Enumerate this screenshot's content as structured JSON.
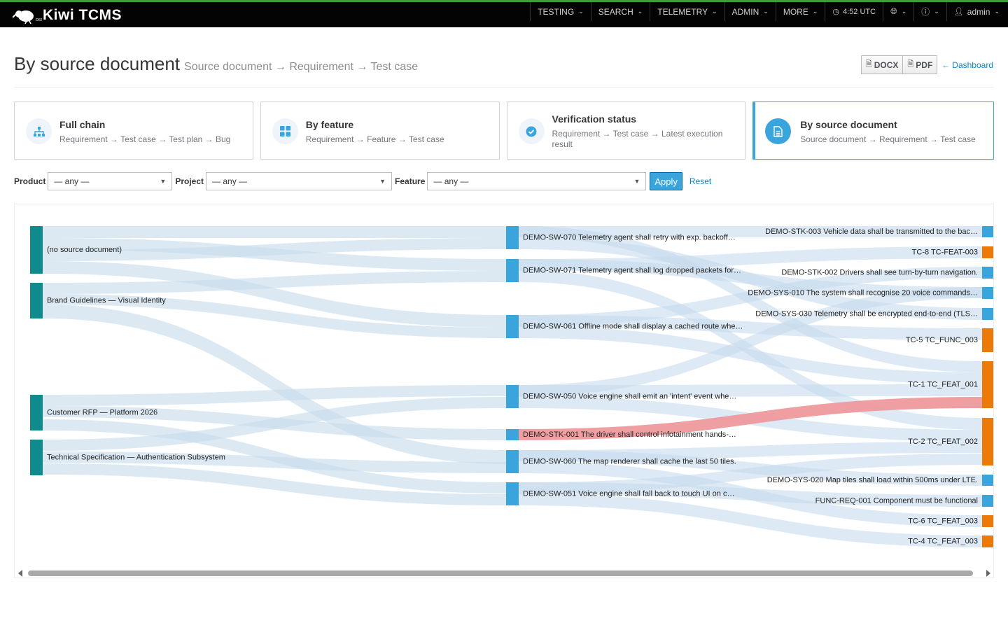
{
  "app": {
    "brand": "Kiwi TCMS"
  },
  "nav": {
    "items": [
      {
        "label": "TESTING"
      },
      {
        "label": "SEARCH"
      },
      {
        "label": "TELEMETRY"
      },
      {
        "label": "ADMIN"
      },
      {
        "label": "MORE"
      }
    ],
    "time": "4:52 UTC",
    "user": "admin"
  },
  "header": {
    "title": "By source document",
    "subtitle": "Source document → Requirement → Test case",
    "docx_label": "DOCX",
    "pdf_label": "PDF",
    "dashboard_label": "Dashboard"
  },
  "cards": [
    {
      "title": "Full chain",
      "desc": "Requirement → Test case → Test plan → Bug",
      "icon": "sitemap-icon"
    },
    {
      "title": "By feature",
      "desc": "Requirement → Feature → Test case",
      "icon": "grid-icon"
    },
    {
      "title": "Verification status",
      "desc": "Requirement → Test case → Latest execution result",
      "icon": "check-circle-icon"
    },
    {
      "title": "By source document",
      "desc": "Source document → Requirement → Test case",
      "icon": "document-icon",
      "active": true
    }
  ],
  "filters": {
    "product_label": "Product",
    "product_value": "— any —",
    "project_label": "Project",
    "project_value": "— any —",
    "feature_label": "Feature",
    "feature_value": "— any —",
    "apply_label": "Apply",
    "reset_label": "Reset"
  },
  "colors": {
    "source_node": "#0f8b8d",
    "requirement_node": "#39a5dc",
    "testcase_node": "#ec7a08",
    "link": "#c6dbec",
    "highlight_link": "#ee9a9d"
  },
  "sankey": {
    "sources": [
      "(no source document)",
      "Brand Guidelines — Visual Identity",
      "Customer RFP — Platform 2026",
      "Technical Specification — Authentication Subsystem"
    ],
    "requirements": [
      "DEMO-SW-070 Telemetry agent shall retry with exp. backoff…",
      "DEMO-SW-071 Telemetry agent shall log dropped packets for…",
      "DEMO-SW-061 Offline mode shall display a cached route whe…",
      "DEMO-SW-050 Voice engine shall emit an 'intent' event whe…",
      "DEMO-STK-001 The driver shall control infotainment hands-…",
      "DEMO-SW-060 The map renderer shall cache the last 50 tiles.",
      "DEMO-SW-051 Voice engine shall fall back to touch UI on c…"
    ],
    "targets": [
      {
        "label": "DEMO-STK-003 Vehicle data shall be transmitted to the bac…",
        "kind": "req"
      },
      {
        "label": "TC-8 TC-FEAT-003",
        "kind": "tc"
      },
      {
        "label": "DEMO-STK-002 Drivers shall see turn-by-turn navigation.",
        "kind": "req"
      },
      {
        "label": "DEMO-SYS-010 The system shall recognise 20 voice commands…",
        "kind": "req"
      },
      {
        "label": "DEMO-SYS-030 Telemetry shall be encrypted end-to-end (TLS…",
        "kind": "req"
      },
      {
        "label": "TC-5 TC_FUNC_003",
        "kind": "tc"
      },
      {
        "label": "TC-1 TC_FEAT_001",
        "kind": "tc"
      },
      {
        "label": "TC-2 TC_FEAT_002",
        "kind": "tc"
      },
      {
        "label": "DEMO-SYS-020 Map tiles shall load within 500ms under LTE.",
        "kind": "req"
      },
      {
        "label": "FUNC-REQ-001 Component must be functional",
        "kind": "req"
      },
      {
        "label": "TC-6 TC_FEAT_003",
        "kind": "tc"
      },
      {
        "label": "TC-4 TC_FEAT_003",
        "kind": "tc"
      }
    ]
  }
}
